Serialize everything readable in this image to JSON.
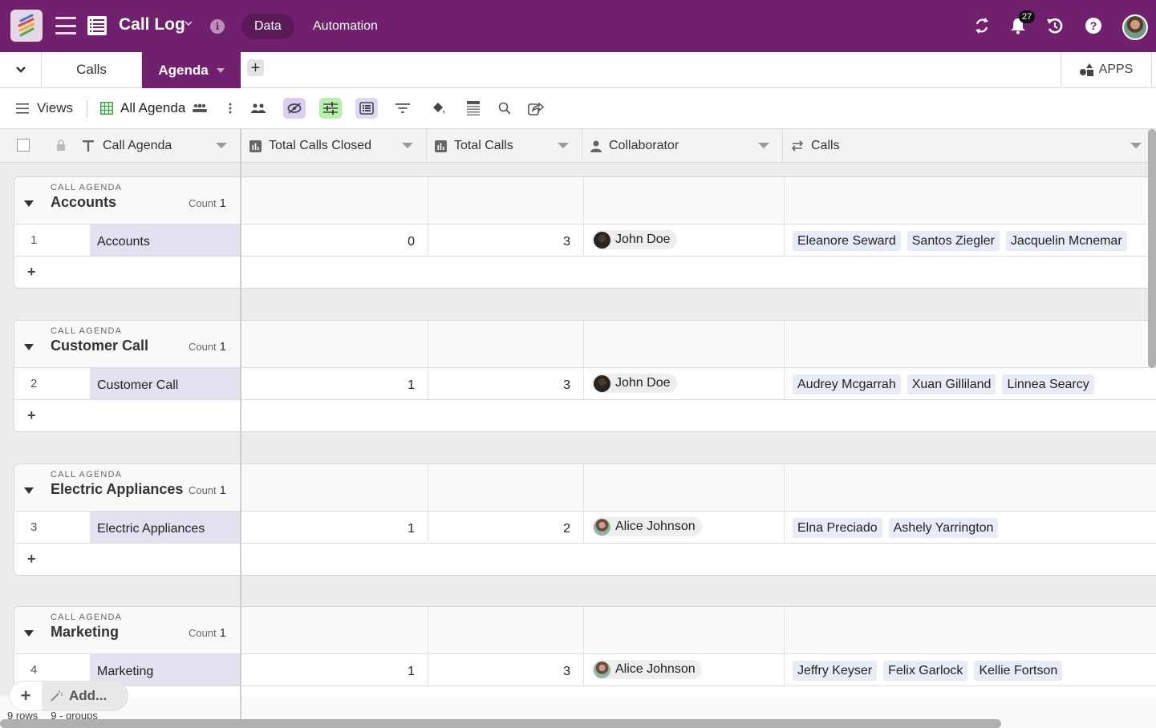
{
  "app": {
    "title": "Call Log",
    "nav_tabs": [
      {
        "label": "Data",
        "active": true
      },
      {
        "label": "Automation",
        "active": false
      }
    ],
    "notifications_count": "27",
    "accent_color": "#71206e"
  },
  "tables": {
    "tabs": [
      {
        "label": "Calls",
        "active": false
      },
      {
        "label": "Agenda",
        "active": true
      }
    ],
    "apps_label": "APPS"
  },
  "toolbar": {
    "views_label": "Views",
    "view_name": "All Agenda"
  },
  "columns": [
    {
      "label": "Call Agenda",
      "type": "text-icon"
    },
    {
      "label": "Total Calls Closed",
      "type": "rollup-icon"
    },
    {
      "label": "Total Calls",
      "type": "rollup-icon"
    },
    {
      "label": "Collaborator",
      "type": "person-icon"
    },
    {
      "label": "Calls",
      "type": "link-icon"
    }
  ],
  "group_field_label": "CALL AGENDA",
  "count_label": "Count",
  "groups": [
    {
      "value": "Accounts",
      "count": "1",
      "row": {
        "num": "1",
        "call_agenda": "Accounts",
        "total_calls_closed": "0",
        "total_calls": "3",
        "collaborator": "John Doe",
        "avatar": "john",
        "calls": [
          "Eleanore Seward",
          "Santos Ziegler",
          "Jacquelin Mcnemar"
        ]
      }
    },
    {
      "value": "Customer Call",
      "count": "1",
      "row": {
        "num": "2",
        "call_agenda": "Customer Call",
        "total_calls_closed": "1",
        "total_calls": "3",
        "collaborator": "John Doe",
        "avatar": "john",
        "calls": [
          "Audrey Mcgarrah",
          "Xuan Gilliland",
          "Linnea Searcy"
        ]
      }
    },
    {
      "value": "Electric Appliances",
      "count": "1",
      "row": {
        "num": "3",
        "call_agenda": "Electric Appliances",
        "total_calls_closed": "1",
        "total_calls": "2",
        "collaborator": "Alice Johnson",
        "avatar": "alice",
        "calls": [
          "Elna Preciado",
          "Ashely Yarrington"
        ]
      }
    },
    {
      "value": "Marketing",
      "count": "1",
      "row": {
        "num": "4",
        "call_agenda": "Marketing",
        "total_calls_closed": "1",
        "total_calls": "3",
        "collaborator": "Alice Johnson",
        "avatar": "alice",
        "calls": [
          "Jeffry Keyser",
          "Felix Garlock",
          "Kellie Fortson"
        ]
      }
    }
  ],
  "footer": {
    "add_label": "Add...",
    "rows_label": "9 rows",
    "groups_label": "9 - groups"
  }
}
